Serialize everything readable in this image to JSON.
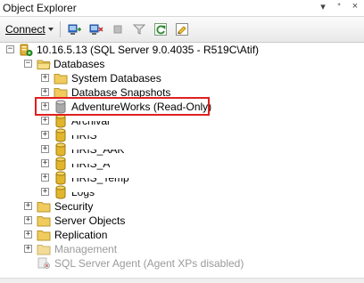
{
  "window": {
    "title": "Object Explorer",
    "controls": [
      "▾",
      "ᐩ",
      "×"
    ]
  },
  "toolbar": {
    "connect_label": "Connect",
    "buttons": [
      {
        "icon": "connect-icon"
      },
      {
        "icon": "disconnect-icon"
      },
      {
        "icon": "stop-icon"
      },
      {
        "icon": "filter-icon"
      },
      {
        "icon": "refresh-icon"
      },
      {
        "icon": "summary-icon"
      }
    ]
  },
  "tree": {
    "server": {
      "label": "10.16.5.13 (SQL Server 9.0.4035 - R519C\\Atif)",
      "expanded": true
    },
    "databases": {
      "label": "Databases",
      "expanded": true
    },
    "items": [
      {
        "label": "System Databases",
        "type": "folder",
        "expander": "+"
      },
      {
        "label": "Database Snapshots",
        "type": "folder",
        "expander": "+"
      },
      {
        "label": "AdventureWorks (Read-Only)",
        "type": "database-readonly",
        "expander": "+",
        "highlighted": true
      },
      {
        "label": "Archival",
        "type": "database",
        "expander": "+"
      },
      {
        "label": "HRIS",
        "type": "database",
        "expander": "+"
      },
      {
        "label": "HRIS_AAK",
        "type": "database",
        "expander": "+"
      },
      {
        "label": "HRIS_A",
        "type": "database",
        "expander": "+"
      },
      {
        "label": "HRIS_Temp",
        "type": "database",
        "expander": "+"
      },
      {
        "label": "Logs",
        "type": "database",
        "expander": "+"
      }
    ],
    "server_children": [
      {
        "label": "Security",
        "type": "folder",
        "expander": "+",
        "disabled": false
      },
      {
        "label": "Server Objects",
        "type": "folder",
        "expander": "+",
        "disabled": false
      },
      {
        "label": "Replication",
        "type": "folder",
        "expander": "+",
        "disabled": false
      },
      {
        "label": "Management",
        "type": "folder",
        "expander": "+",
        "disabled": true
      },
      {
        "label": "SQL Server Agent (Agent XPs disabled)",
        "type": "agent",
        "expander": "",
        "disabled": true
      }
    ]
  },
  "colors": {
    "highlight_border": "#e0201f",
    "folder": "#e8c65a",
    "database": "#d8b02a",
    "readonly_db": "#a9a9a9",
    "disabled_text": "#9a9a9a"
  }
}
